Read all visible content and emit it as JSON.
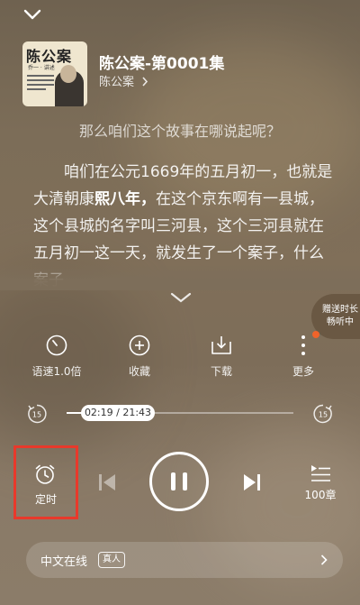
{
  "header": {
    "episode_title": "陈公案-第0001集",
    "album_name": "陈公案",
    "cover": {
      "title": "陈公案",
      "subtitle": "乔一 · 讲述"
    }
  },
  "lyrics": {
    "previous_line": "那么咱们这个故事在哪说起呢？",
    "current_before": "咱们在公元1669年的五月初一，也就是大清朝康",
    "current_highlight": "熙八年，",
    "current_after": "在这个京东啊有一县城，这个县城的名字叫三河县，这个三河县就在五月初一这一天，就发生了一个案子，什么案子"
  },
  "promo": {
    "line1": "赠送时长",
    "line2": "畅听中"
  },
  "toolbar": {
    "speed_label": "语速1.0倍",
    "favorite_label": "收藏",
    "download_label": "下载",
    "more_label": "更多"
  },
  "progress": {
    "skip_back_seconds": "15",
    "skip_forward_seconds": "15",
    "time_display": "02:19 / 21:43",
    "fraction": 0.107
  },
  "controls": {
    "timer_label": "定时",
    "playlist_label": "100章"
  },
  "voice": {
    "name": "中文在线",
    "tag": "真人"
  },
  "colors": {
    "accent_red": "#e8392b",
    "notify_dot": "#f0632a"
  }
}
